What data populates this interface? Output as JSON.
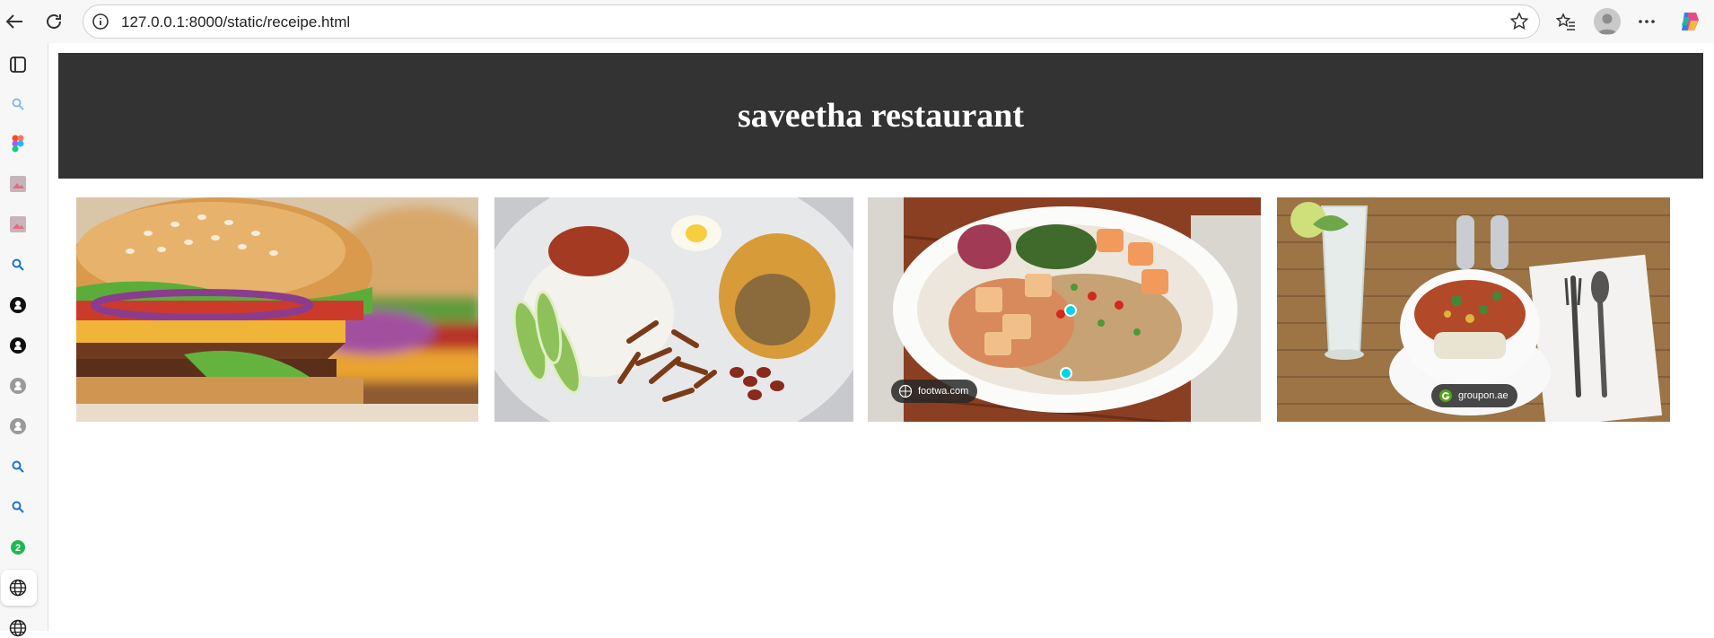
{
  "browser": {
    "url": "127.0.0.1:8000/static/receipe.html"
  },
  "page": {
    "title": "saveetha restaurant"
  },
  "gallery": {
    "items": [
      {
        "alt": "burger"
      },
      {
        "alt": "nasi lemak"
      },
      {
        "alt": "rice plate",
        "source": "footwa.com"
      },
      {
        "alt": "soup bowl",
        "source": "groupon.ae"
      }
    ]
  },
  "sidebar": {
    "badge_count": "2"
  },
  "colors": {
    "header_bg": "#333333",
    "header_text": "#ffffff",
    "visual_search_dot": "#00d6e8"
  }
}
